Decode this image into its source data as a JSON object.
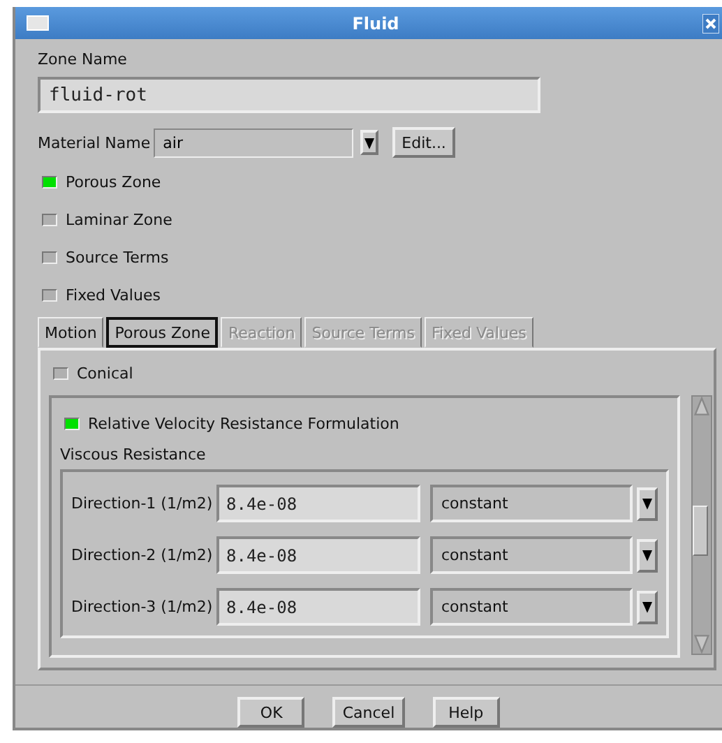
{
  "window": {
    "title": "Fluid"
  },
  "zone_name": {
    "label": "Zone Name",
    "value": "fluid-rot"
  },
  "material": {
    "label": "Material Name",
    "value": "air",
    "edit_button": "Edit..."
  },
  "options": [
    {
      "label": "Porous Zone",
      "checked": true
    },
    {
      "label": "Laminar Zone",
      "checked": false
    },
    {
      "label": "Source Terms",
      "checked": false
    },
    {
      "label": "Fixed Values",
      "checked": false
    }
  ],
  "tabs": [
    {
      "label": "Motion",
      "selected": false,
      "disabled": false
    },
    {
      "label": "Porous Zone",
      "selected": true,
      "disabled": false
    },
    {
      "label": "Reaction",
      "selected": false,
      "disabled": true
    },
    {
      "label": "Source Terms",
      "selected": false,
      "disabled": true
    },
    {
      "label": "Fixed Values",
      "selected": false,
      "disabled": true
    }
  ],
  "porous": {
    "conical": {
      "label": "Conical",
      "checked": false
    },
    "relative_velocity": {
      "label": "Relative Velocity Resistance Formulation",
      "checked": true
    },
    "viscous_resistance": {
      "label": "Viscous Resistance",
      "rows": [
        {
          "label": "Direction-1 (1/m2)",
          "value": "8.4e-08",
          "method": "constant"
        },
        {
          "label": "Direction-2 (1/m2)",
          "value": "8.4e-08",
          "method": "constant"
        },
        {
          "label": "Direction-3 (1/m2)",
          "value": "8.4e-08",
          "method": "constant"
        }
      ]
    }
  },
  "buttons": [
    "OK",
    "Cancel",
    "Help"
  ]
}
